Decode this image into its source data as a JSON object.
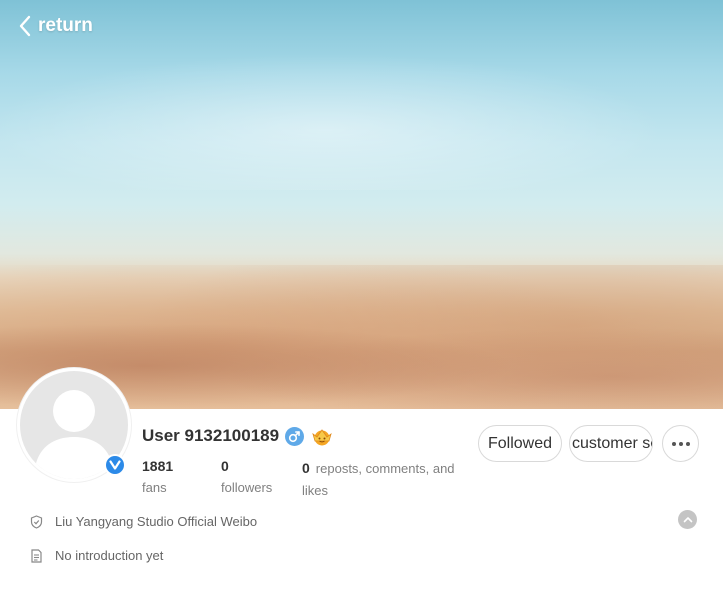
{
  "header": {
    "return_label": "return"
  },
  "profile": {
    "user_name": "User 9132100189",
    "stats": {
      "fans_count": "1881",
      "fans_label": "fans",
      "followers_count": "0",
      "followers_label": "followers",
      "reposts_count": "0",
      "reposts_label": "reposts, comments, and likes"
    }
  },
  "actions": {
    "followed_label": "Followed",
    "customer_service_label": "customer service"
  },
  "info": {
    "studio": "Liu Yangyang Studio Official Weibo",
    "intro": "No introduction yet"
  },
  "icons": {
    "back": "chevron-left-icon",
    "verified": "verified-v-icon",
    "gender": "male-icon",
    "level": "crown-level-icon",
    "more": "more-dots-icon",
    "shield": "shield-icon",
    "document": "document-icon",
    "collapse": "chevron-up-icon"
  },
  "colors": {
    "verified_blue": "#2c8ae8",
    "gender_blue": "#5fa9e8",
    "muted_text": "#808080"
  }
}
